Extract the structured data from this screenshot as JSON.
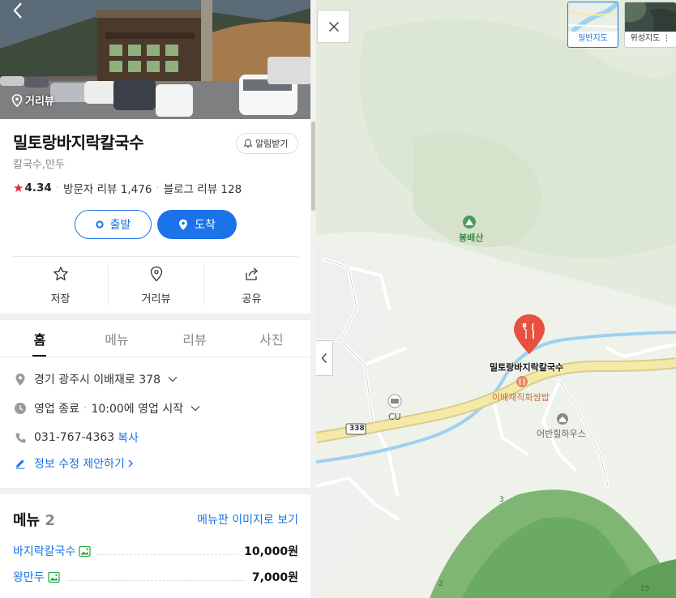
{
  "header": {
    "streetview_label": "거리뷰"
  },
  "place": {
    "name": "밀토랑바지락칼국수",
    "notify_label": "알림받기",
    "category": "칼국수,만두",
    "rating": "4.34",
    "visitor_review_label": "방문자 리뷰",
    "visitor_review_count": "1,476",
    "blog_review_label": "블로그 리뷰",
    "blog_review_count": "128"
  },
  "route": {
    "start_label": "출발",
    "arrive_label": "도착"
  },
  "actions": {
    "save_label": "저장",
    "streetview_label": "거리뷰",
    "share_label": "공유"
  },
  "tabs": [
    {
      "label": "홈",
      "active": true
    },
    {
      "label": "메뉴",
      "active": false
    },
    {
      "label": "리뷰",
      "active": false
    },
    {
      "label": "사진",
      "active": false
    }
  ],
  "info": {
    "address": "경기 광주시 이배재로 378",
    "hours_status": "영업 종료",
    "hours_next": "10:00에 영업 시작",
    "phone": "031-767-4363",
    "copy_label": "복사",
    "edit_suggest_label": "정보 수정 제안하기"
  },
  "menu": {
    "title": "메뉴",
    "count": "2",
    "image_link_label": "메뉴판 이미지로 보기",
    "items": [
      {
        "name": "바지락칼국수",
        "price": "10,000원"
      },
      {
        "name": "왕만두",
        "price": "7,000원"
      }
    ]
  },
  "map": {
    "map_type_normal": "일반지도",
    "map_type_satellite": "위성지도",
    "mountain_name": "봉배산",
    "pin_label": "밀토랑바지락칼국수",
    "poi_restaurant": "이배재직화쌈밥",
    "poi_lodging": "어반힐하우스",
    "store_cu": "CU",
    "route_number": "338",
    "contour_labels": [
      "3",
      "2",
      "15"
    ]
  },
  "colors": {
    "accent_blue": "#1a73e8",
    "pin_red": "#e8503f",
    "poi_orange": "#e5895a",
    "mountain_green": "#4a9a5b",
    "star_red": "#e52b2b"
  }
}
